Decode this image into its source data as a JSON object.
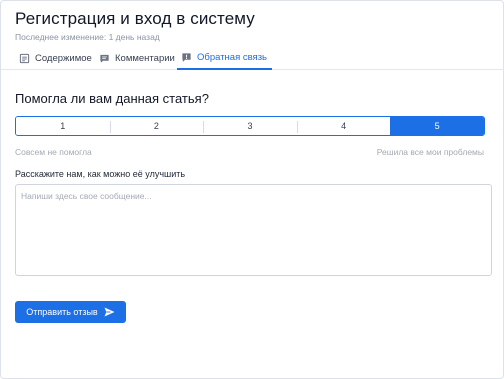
{
  "page": {
    "title": "Регистрация и вход в систему",
    "subtitle": "Последнее изменение: 1 день назад"
  },
  "tabs": [
    {
      "label": "Содержимое",
      "icon": "document-icon",
      "active": false
    },
    {
      "label": "Комментарии",
      "icon": "comment-icon",
      "active": false
    },
    {
      "label": "Обратная связь",
      "icon": "feedback-icon",
      "active": true
    }
  ],
  "feedback": {
    "question": "Помогла ли вам данная статья?",
    "scale": [
      "1",
      "2",
      "3",
      "4",
      "5"
    ],
    "selected": "5",
    "hint_low": "Совсем не помогла",
    "hint_high": "Решила все мои проблемы",
    "improve_label": "Расскажите нам, как можно её улучшить",
    "message_placeholder": "Напиши здесь свое сообщение...",
    "message_value": "",
    "submit_label": "Отправить отзыв",
    "submit_icon": "send-icon"
  },
  "colors": {
    "accent": "#1d6fe6",
    "muted_text": "#8b94a3",
    "border": "#cfd5de"
  }
}
